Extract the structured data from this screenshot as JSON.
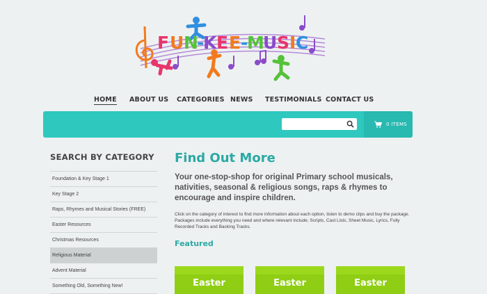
{
  "brand": {
    "name": "FUN-KEE-MUSIC"
  },
  "nav": {
    "items": [
      {
        "label": "HOME",
        "active": true
      },
      {
        "label": "ABOUT US"
      },
      {
        "label": "CATEGORIES"
      },
      {
        "label": "NEWS"
      },
      {
        "label": "TESTIMONIALS"
      },
      {
        "label": "CONTACT US"
      }
    ]
  },
  "search": {
    "placeholder": "",
    "icon": "search-icon"
  },
  "cart": {
    "label": "0 ITEMS",
    "icon": "cart-icon"
  },
  "colors": {
    "accent": "#2ec8bf",
    "heading": "#2aa9a5",
    "card": "#8fce14"
  },
  "sidebar": {
    "title": "SEARCH BY CATEGORY",
    "items": [
      {
        "label": "Foundation & Key Stage 1"
      },
      {
        "label": "Key Stage 2"
      },
      {
        "label": "Raps, Rhymes and Musical Stories (FREE)"
      },
      {
        "label": "Easter Resources"
      },
      {
        "label": "Christmas Resources"
      },
      {
        "label": "Religious Material",
        "active": true
      },
      {
        "label": "Advent Material"
      },
      {
        "label": "Something Old, Something New!"
      }
    ]
  },
  "main": {
    "title": "Find Out More",
    "lead": "Your one-stop-shop for original Primary school musicals, nativities, seasonal & religious songs, raps & rhymes to encourage and inspire children.",
    "body": "Click on the category of interest to find more information about each option, listen to demo clips and buy the package. Packages include everything you need and where relevant include; Scripts, Cast Lists, Sheet Music, Lyrics, Fully Recorded Tracks and Backing Tracks.",
    "featured_title": "Featured",
    "featured": [
      {
        "label": "Easter"
      },
      {
        "label": "Easter"
      },
      {
        "label": "Easter"
      }
    ]
  }
}
